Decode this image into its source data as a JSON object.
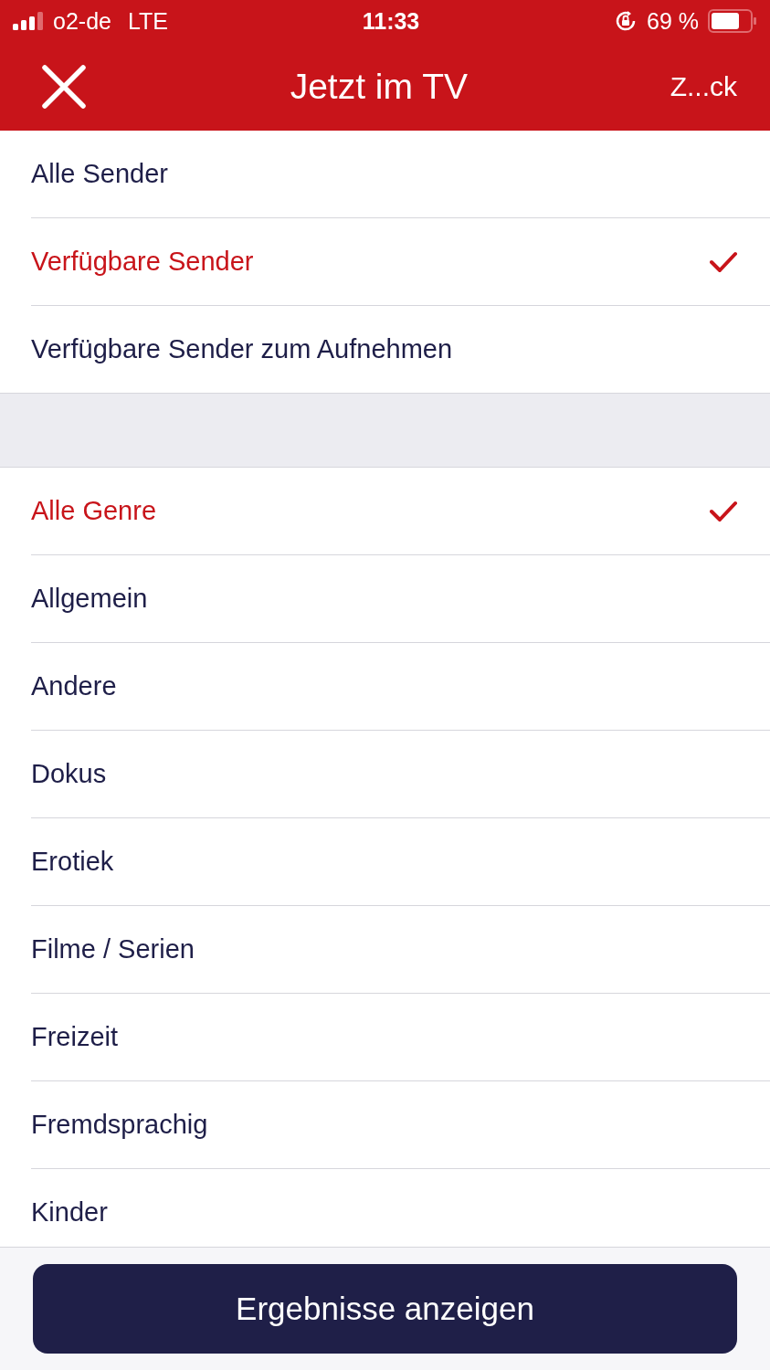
{
  "status_bar": {
    "carrier": "o2-de",
    "network": "LTE",
    "time": "11:33",
    "battery": "69 %"
  },
  "nav": {
    "title": "Jetzt im TV",
    "back_label": "Z...ck"
  },
  "sections": [
    {
      "items": [
        {
          "label": "Alle Sender",
          "selected": false
        },
        {
          "label": "Verfügbare Sender",
          "selected": true
        },
        {
          "label": "Verfügbare Sender zum Aufnehmen",
          "selected": false
        }
      ]
    },
    {
      "items": [
        {
          "label": "Alle Genre",
          "selected": true
        },
        {
          "label": "Allgemein",
          "selected": false
        },
        {
          "label": "Andere",
          "selected": false
        },
        {
          "label": "Dokus",
          "selected": false
        },
        {
          "label": "Erotiek",
          "selected": false
        },
        {
          "label": "Filme / Serien",
          "selected": false
        },
        {
          "label": "Freizeit",
          "selected": false
        },
        {
          "label": "Fremdsprachig",
          "selected": false
        },
        {
          "label": "Kinder",
          "selected": false
        }
      ]
    }
  ],
  "button": {
    "label": "Ergebnisse anzeigen"
  }
}
